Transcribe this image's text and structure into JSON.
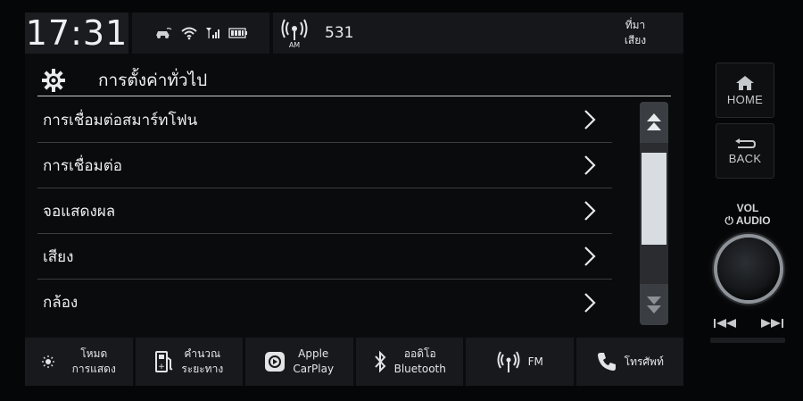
{
  "status_bar": {
    "clock": "17:31",
    "icons": [
      "car-connect-icon",
      "wifi-icon",
      "signal-icon",
      "battery-icon"
    ],
    "audio": {
      "band_icon": "am-radio-icon",
      "band_label": "AM",
      "station": "531"
    },
    "source": {
      "line1": "ที่มา",
      "line2": "เสียง"
    }
  },
  "header": {
    "title": "การตั้งค่าทั่วไป",
    "icon": "gear-icon"
  },
  "menu": {
    "items": [
      {
        "label": "การเชื่อมต่อสมาร์ทโฟน"
      },
      {
        "label": "การเชื่อมต่อ"
      },
      {
        "label": "จอแสดงผล"
      },
      {
        "label": "เสียง"
      },
      {
        "label": "กล้อง"
      }
    ]
  },
  "scrollbar": {
    "position": 0.2,
    "visible_fraction": 0.65
  },
  "bottom_bar": {
    "display_mode": {
      "line1": "โหมด",
      "line2": "การแสดง"
    },
    "distance": {
      "line1": "คำนวณ",
      "line2": "ระยะทาง"
    },
    "carplay": {
      "line1": "Apple",
      "line2": "CarPlay"
    },
    "bluetooth": {
      "line1": "ออดิโอ",
      "line2": "Bluetooth"
    },
    "fm": {
      "label": "FM"
    },
    "phone": {
      "label": "โทรศัพท์"
    }
  },
  "hardware": {
    "home_label": "HOME",
    "back_label": "BACK",
    "vol_line1": "VOL",
    "vol_line2": "AUDIO"
  },
  "colors": {
    "background": "#0a0b0d",
    "panel": "#17191c",
    "text": "#eceef0",
    "scroll_thumb": "#d8dde2"
  }
}
